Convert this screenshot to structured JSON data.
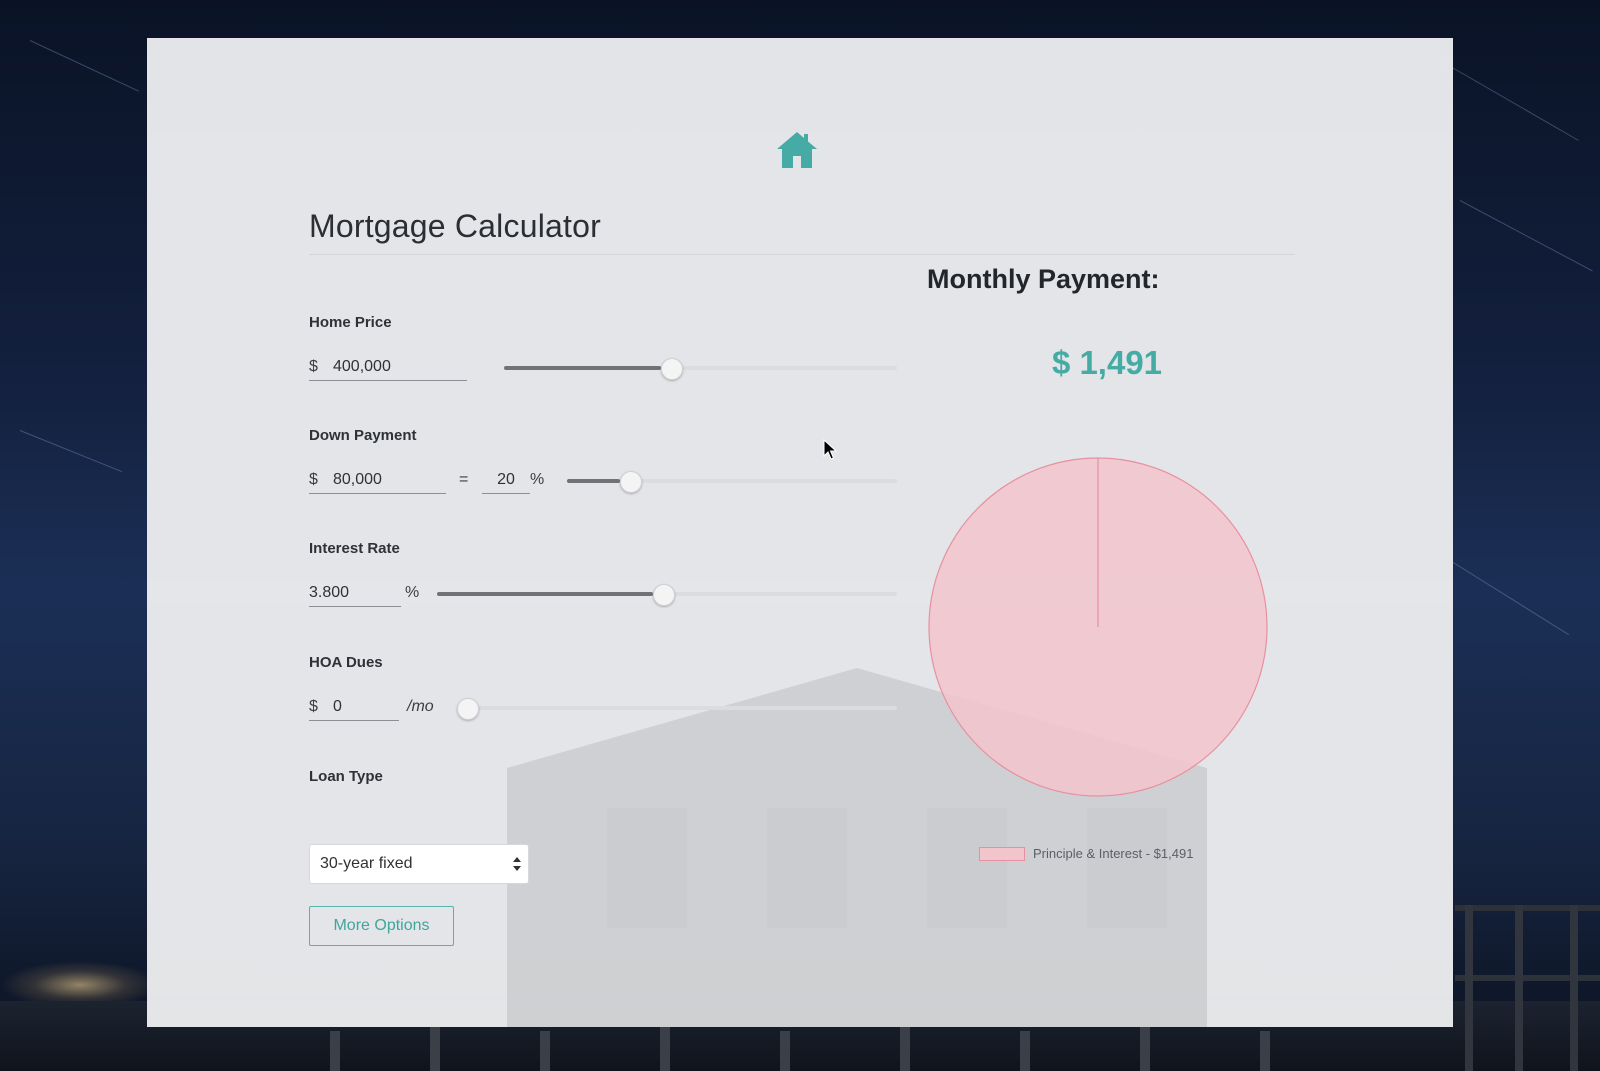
{
  "app": {
    "title": "Mortgage Calculator",
    "accent_color": "#45aba4",
    "icon": "home-icon"
  },
  "form": {
    "home_price": {
      "label": "Home Price",
      "currency_symbol": "$",
      "value": "400,000",
      "slider_fraction": 0.4
    },
    "down_payment": {
      "label": "Down Payment",
      "currency_symbol": "$",
      "value": "80,000",
      "equals_symbol": "=",
      "percent_value": "20",
      "percent_symbol": "%",
      "slider_fraction": 0.16
    },
    "interest_rate": {
      "label": "Interest Rate",
      "value": "3.800",
      "percent_symbol": "%",
      "slider_fraction": 0.47
    },
    "hoa_dues": {
      "label": "HOA Dues",
      "currency_symbol": "$",
      "value": "0",
      "unit": "/mo",
      "slider_fraction": 0.0
    },
    "loan_type": {
      "label": "Loan Type",
      "selected": "30-year fixed"
    },
    "more_options_label": "More Options"
  },
  "result": {
    "title": "Monthly Payment:",
    "amount": "$ 1,491"
  },
  "chart_data": {
    "type": "pie",
    "slices": [
      {
        "label": "Principle & Interest - $1,491",
        "value": 1491,
        "color": "#f2c4cc",
        "stroke": "#e8909f"
      }
    ],
    "legend_placement": "bottom"
  }
}
